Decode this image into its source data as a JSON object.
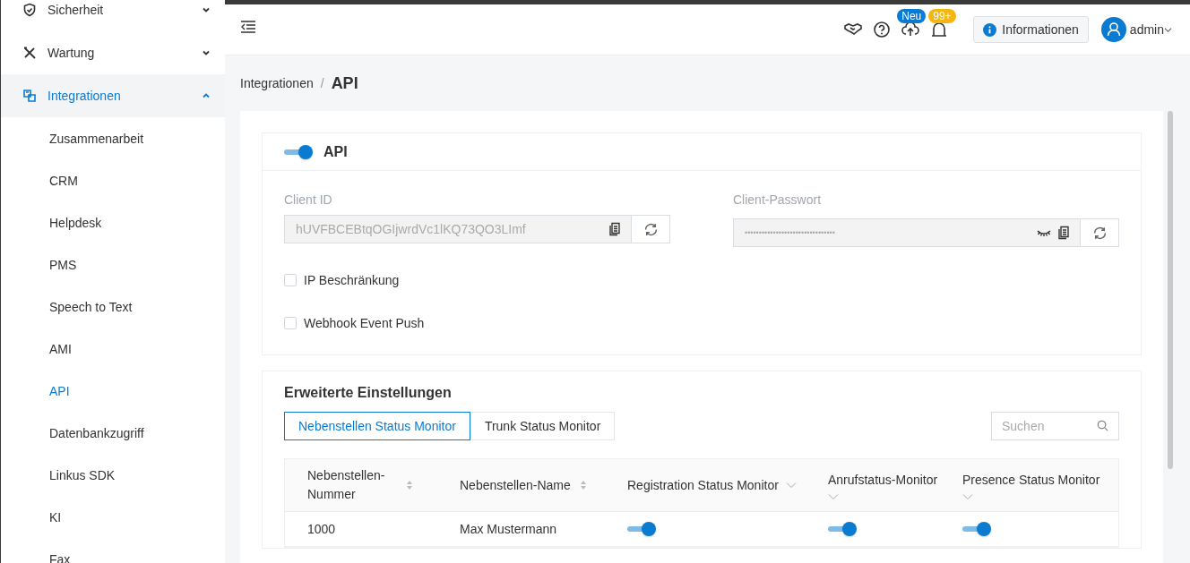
{
  "sidebar": {
    "items": [
      {
        "label": "Sicherheit",
        "expanded": false,
        "selected": false
      },
      {
        "label": "Wartung",
        "expanded": false,
        "selected": false
      },
      {
        "label": "Integrationen",
        "expanded": true,
        "selected": true,
        "children": [
          {
            "label": "Zusammenarbeit",
            "selected": false
          },
          {
            "label": "CRM",
            "selected": false
          },
          {
            "label": "Helpdesk",
            "selected": false
          },
          {
            "label": "PMS",
            "selected": false
          },
          {
            "label": "Speech to Text",
            "selected": false
          },
          {
            "label": "AMI",
            "selected": false
          },
          {
            "label": "API",
            "selected": true
          },
          {
            "label": "Datenbankzugriff",
            "selected": false
          },
          {
            "label": "Linkus SDK",
            "selected": false
          },
          {
            "label": "KI",
            "selected": false
          },
          {
            "label": "Fax",
            "selected": false
          }
        ]
      }
    ]
  },
  "header": {
    "update_badge": "Neu",
    "notification_badge": "99+",
    "info_button": "Informationen",
    "user": "admin"
  },
  "breadcrumb": {
    "parent": "Integrationen",
    "separator": "/",
    "current": "API"
  },
  "api_panel": {
    "title": "API",
    "enabled": true,
    "client_id": {
      "label": "Client ID",
      "value": "hUVFBCEBtqOGIjwrdVc1lKQ73QO3LImf"
    },
    "client_password": {
      "label": "Client-Passwort",
      "value": "••••••••••••••••••••••••••••••••"
    },
    "options": [
      {
        "label": "IP Beschränkung",
        "checked": false
      },
      {
        "label": "Webhook Event Push",
        "checked": false
      }
    ]
  },
  "advanced": {
    "title": "Erweiterte Einstellungen",
    "tabs": [
      {
        "label": "Nebenstellen Status Monitor",
        "selected": true
      },
      {
        "label": "Trunk Status Monitor",
        "selected": false
      }
    ],
    "search": {
      "placeholder": "Suchen"
    },
    "table": {
      "columns": [
        {
          "label": "Nebenstellen-Nummer",
          "kind": "sort"
        },
        {
          "label": "Nebenstellen-Name",
          "kind": "sort"
        },
        {
          "label": "Registration Status Monitor",
          "kind": "filter"
        },
        {
          "label": "Anrufstatus-Monitor",
          "kind": "filter"
        },
        {
          "label": "Presence Status Monitor",
          "kind": "filter"
        }
      ],
      "rows": [
        {
          "number": "1000",
          "name": "Max Mustermann",
          "registration": true,
          "call": true,
          "presence": true
        }
      ]
    }
  }
}
